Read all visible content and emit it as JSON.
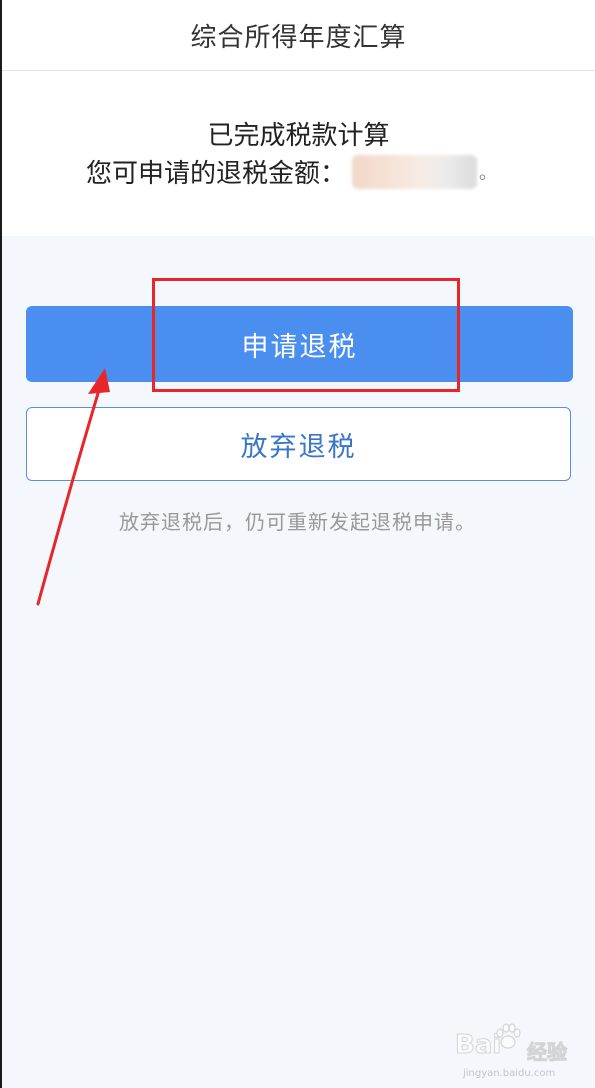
{
  "header": {
    "title": "综合所得年度汇算"
  },
  "summary": {
    "status_text": "已完成税款计算",
    "refund_label": "您可申请的退税金额：",
    "refund_suffix": "。"
  },
  "actions": {
    "apply_label": "申请退税",
    "giveup_label": "放弃退税",
    "hint_text": "放弃退税后，仍可重新发起退税申请。"
  },
  "annotation": {
    "highlight_color": "#e8262a",
    "arrow_color": "#e8262a"
  },
  "watermark": {
    "brand": "Bai",
    "brand2": "经验",
    "url": "jingyan.baidu.com"
  },
  "colors": {
    "primary": "#4a8ef0",
    "outline": "#5b8fd9",
    "background": "#f4f7fb"
  }
}
